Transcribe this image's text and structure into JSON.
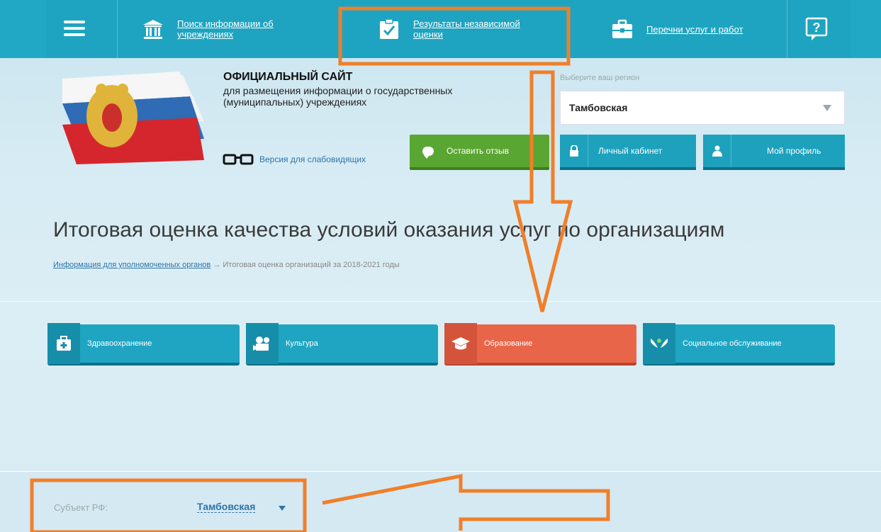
{
  "topnav": {
    "menu_icon": "hamburger-icon",
    "items": [
      {
        "icon": "institution-icon",
        "label": "Поиск информации об учреждениях"
      },
      {
        "icon": "clipboard-check-icon",
        "label": "Результаты независимой оценки"
      },
      {
        "icon": "briefcase-icon",
        "label": "Перечни услуг и работ"
      }
    ],
    "help_icon": "help-question-icon",
    "color": "#1ea4c0"
  },
  "header": {
    "title": "ОФИЦИАЛЬНЫЙ САЙТ",
    "subtitle": "для размещения информации о государственных (муниципальных) учреждениях",
    "vision_link": "Версия для слабовидящих",
    "feedback_button": "Оставить отзыв",
    "region_label": "Выберите ваш регион",
    "region_value": "Тамбовская",
    "cabinet_button": "Личный кабинет",
    "profile_button": "Мой профиль"
  },
  "main": {
    "page_title": "Итоговая оценка качества условий оказания услуг по организациям",
    "breadcrumb_link": "Информация для уполномоченных органов",
    "breadcrumb_current": "→ Итоговая оценка организаций за 2018-2021 годы"
  },
  "categories": [
    {
      "icon": "medkit-icon",
      "label": "Здравоохранение",
      "active": false
    },
    {
      "icon": "film-camera-icon",
      "label": "Культура",
      "active": false
    },
    {
      "icon": "graduation-cap-icon",
      "label": "Образование",
      "active": true
    },
    {
      "icon": "hands-care-icon",
      "label": "Социальное обслуживание",
      "active": false
    }
  ],
  "filter": {
    "subject_label": "Субъект РФ:",
    "subject_value": "Тамбовская"
  },
  "colors": {
    "accent_teal": "#1ea4c0",
    "active_red": "#e8654a",
    "feedback_green": "#5aa632",
    "annotation_orange": "#f07f2a"
  }
}
